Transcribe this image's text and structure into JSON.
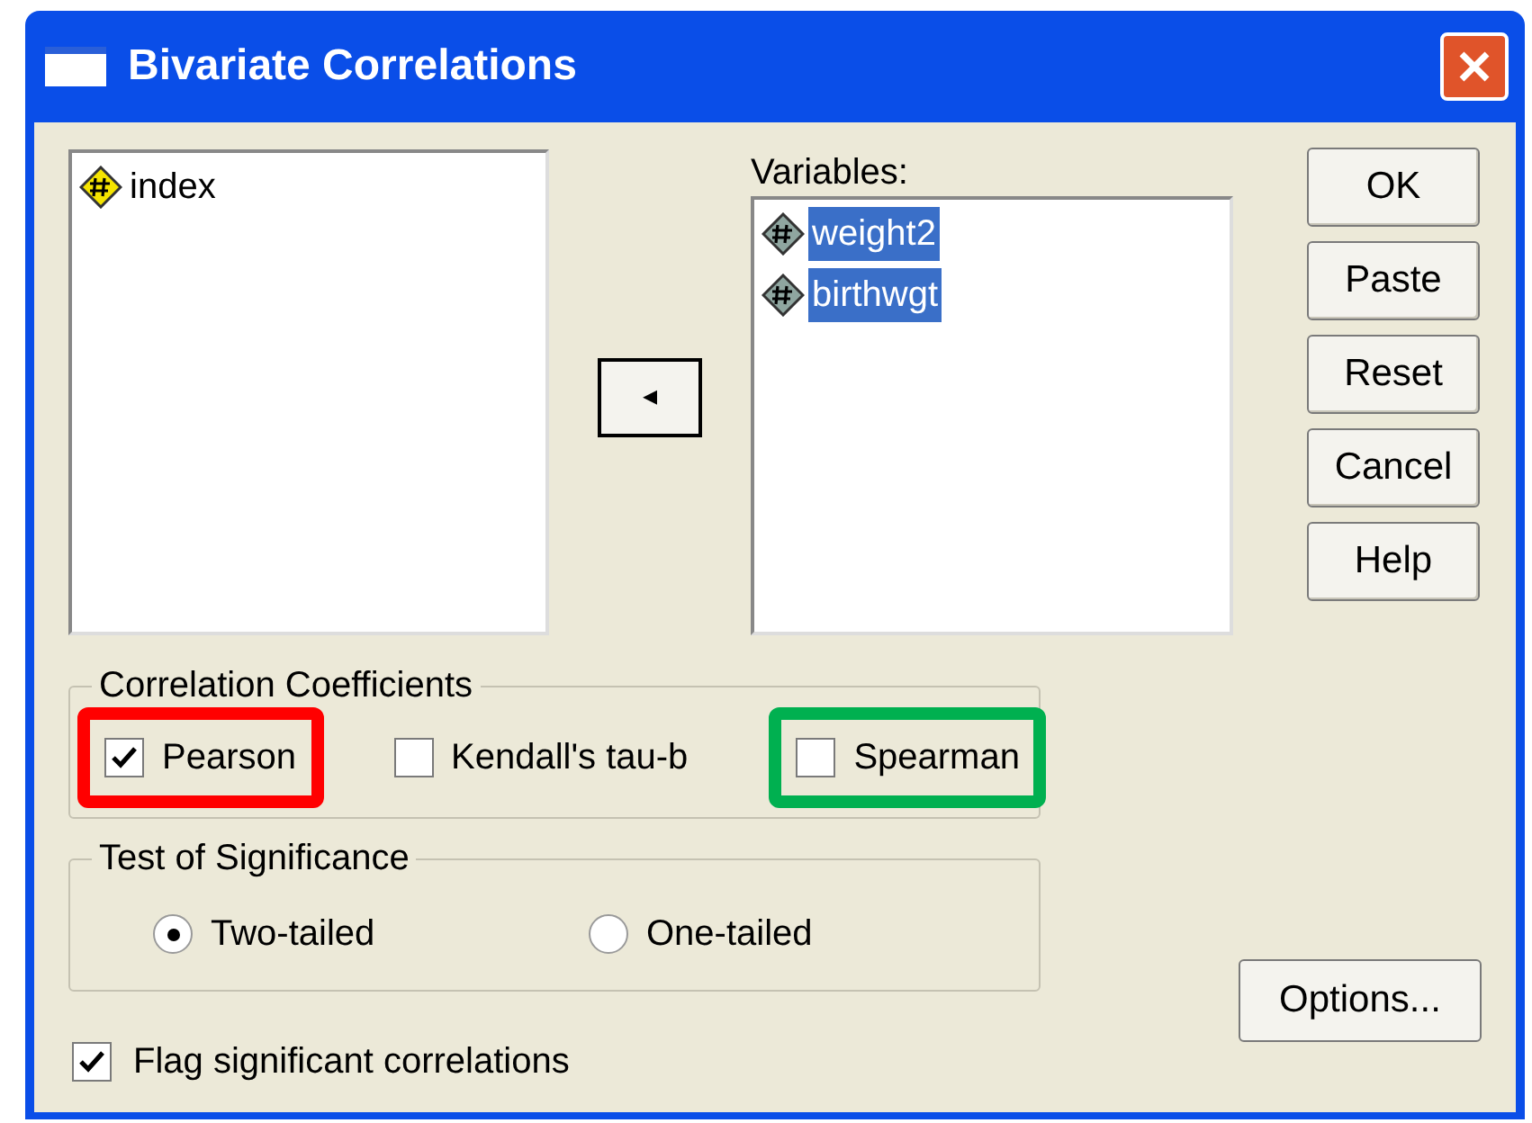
{
  "window": {
    "title": "Bivariate Correlations"
  },
  "source_list": {
    "items": [
      {
        "label": "index",
        "selected": false
      }
    ]
  },
  "move_button": {
    "symbol": "◂"
  },
  "variables": {
    "label": "Variables:",
    "items": [
      {
        "label": "weight2",
        "selected": true
      },
      {
        "label": "birthwgt",
        "selected": true
      }
    ]
  },
  "buttons": [
    "OK",
    "Paste",
    "Reset",
    "Cancel",
    "Help"
  ],
  "correlation_coefficients": {
    "title": "Correlation Coefficients",
    "options": [
      {
        "label": "Pearson",
        "checked": true,
        "color": "#ff0000"
      },
      {
        "label": "Kendall's tau-b",
        "checked": false
      },
      {
        "label": "Spearman",
        "checked": false,
        "color": "#00b050"
      }
    ]
  },
  "test_of_significance": {
    "title": "Test of Significance",
    "options": [
      {
        "label": "Two-tailed",
        "selected": true
      },
      {
        "label": "One-tailed",
        "selected": false
      }
    ]
  },
  "flag": {
    "label": "Flag significant correlations",
    "checked": true
  },
  "options_button": "Options..."
}
